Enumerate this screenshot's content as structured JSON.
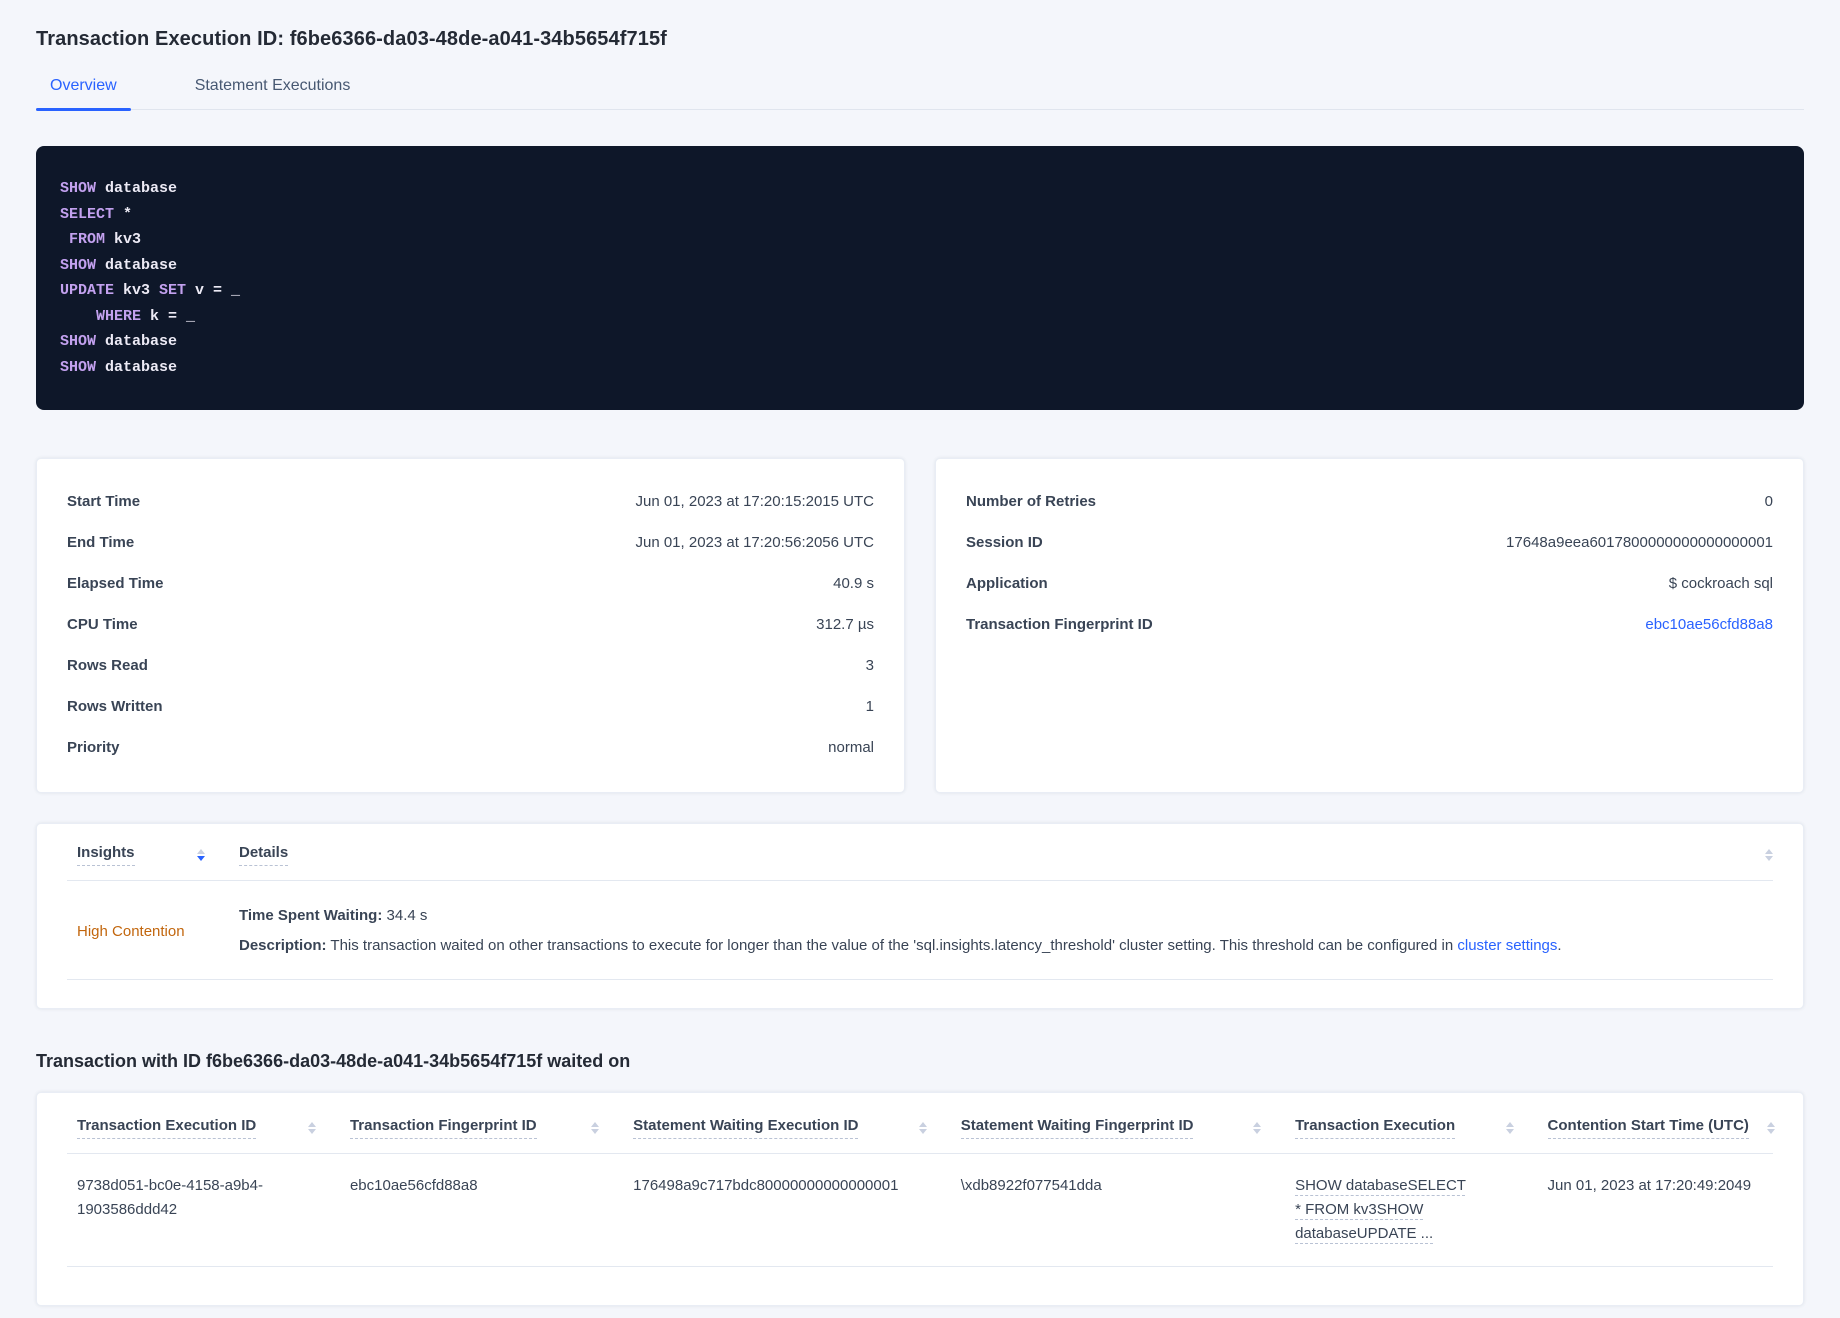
{
  "page": {
    "title": "Transaction Execution ID: f6be6366-da03-48de-a041-34b5654f715f"
  },
  "colors": {
    "accent_blue": "#2962ff",
    "insight_orange": "#c2660d",
    "sql_background": "#0e1729",
    "sql_keyword": "#c3a1ef",
    "page_background": "#f4f6fb"
  },
  "tabs": [
    {
      "label": "Overview",
      "active": true
    },
    {
      "label": "Statement Executions",
      "active": false
    }
  ],
  "sql": {
    "lines": [
      {
        "s0": "SHOW",
        "s1": " database"
      },
      {
        "s0": "SELECT",
        "s1": " *"
      },
      {
        "s0": " ",
        "s1": "FROM",
        "s2": " kv3"
      },
      {
        "s0": "SHOW",
        "s1": " database"
      },
      {
        "s0": "UPDATE",
        "s1": " kv3 ",
        "s2": "SET",
        "s3": " v = _"
      },
      {
        "s0": "    ",
        "s1": "WHERE",
        "s2": " k = _"
      },
      {
        "s0": "SHOW",
        "s1": " database"
      },
      {
        "s0": "SHOW",
        "s1": " database"
      }
    ]
  },
  "left_card": {
    "rows": [
      {
        "label": "Start Time",
        "value": "Jun 01, 2023 at 17:20:15:2015 UTC"
      },
      {
        "label": "End Time",
        "value": "Jun 01, 2023 at 17:20:56:2056 UTC"
      },
      {
        "label": "Elapsed Time",
        "value": "40.9 s"
      },
      {
        "label": "CPU Time",
        "value": "312.7 µs"
      },
      {
        "label": "Rows Read",
        "value": "3"
      },
      {
        "label": "Rows Written",
        "value": "1"
      },
      {
        "label": "Priority",
        "value": "normal"
      }
    ]
  },
  "right_card": {
    "rows": [
      {
        "label": "Number of Retries",
        "value": "0"
      },
      {
        "label": "Session ID",
        "value": "17648a9eea6017800000000000000001"
      },
      {
        "label": "Application",
        "value": "$ cockroach sql"
      },
      {
        "label": "Transaction Fingerprint ID",
        "value": "ebc10ae56cfd88a8"
      }
    ]
  },
  "insights_table": {
    "headers": {
      "insights": "Insights",
      "details": "Details"
    },
    "row": {
      "insight": "High Contention",
      "waiting_label": "Time Spent Waiting:",
      "waiting_value": " 34.4 s",
      "description_label": "Description:",
      "description_text": " This transaction waited on other transactions to execute for longer than the value of the 'sql.insights.latency_threshold' cluster setting. This threshold can be configured in ",
      "description_link": "cluster settings",
      "description_suffix": "."
    }
  },
  "waited_section": {
    "heading": "Transaction with ID f6be6366-da03-48de-a041-34b5654f715f waited on"
  },
  "contention_table": {
    "columns": [
      "Transaction Execution ID",
      "Transaction Fingerprint ID",
      "Statement Waiting Execution ID",
      "Statement Waiting Fingerprint ID",
      "Transaction Execution",
      "Contention Start Time (UTC)"
    ],
    "rows": [
      {
        "txn_execution_id": "9738d051-bc0e-4158-a9b4-1903586ddd42",
        "txn_fingerprint_id": "ebc10ae56cfd88a8",
        "stmt_waiting_execution_id": "176498a9c717bdc80000000000000001",
        "stmt_waiting_fingerprint_id": "\\xdb8922f077541dda",
        "txn_execution": "SHOW databaseSELECT * FROM kv3SHOW databaseUPDATE ...",
        "contention_start_time": "Jun 01, 2023 at 17:20:49:2049"
      }
    ]
  }
}
